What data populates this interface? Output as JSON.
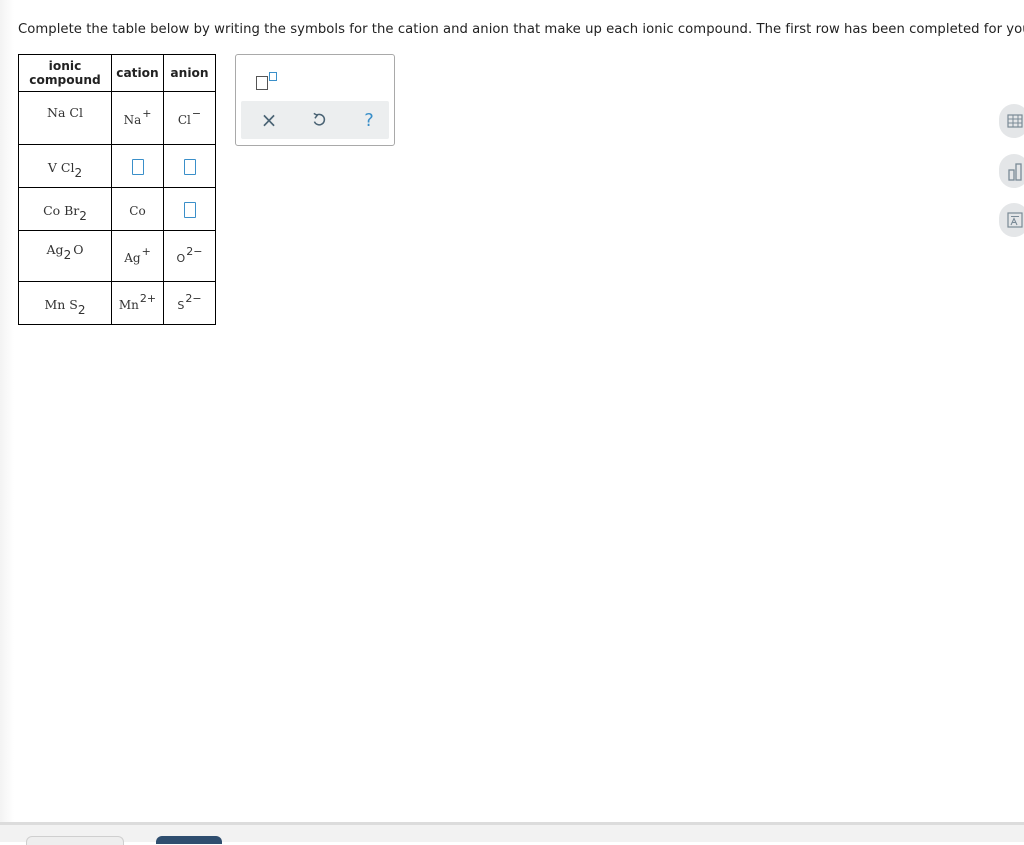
{
  "instructions": "Complete the table below by writing the symbols for the cation and anion that make up each ionic compound. The first row has been completed for you.",
  "table": {
    "headers": {
      "compound_line1": "ionic",
      "compound_line2": "compound",
      "cation": "cation",
      "anion": "anion"
    },
    "rows": [
      {
        "compound": {
          "base": "Na Cl",
          "sub": ""
        },
        "cation": {
          "symbol": "Na",
          "charge": "+"
        },
        "anion": {
          "symbol": "Cl",
          "charge": "−"
        }
      },
      {
        "compound": {
          "base": "V Cl",
          "sub": "2"
        },
        "cation": "blank",
        "anion": "blank"
      },
      {
        "compound": {
          "base": "Co Br",
          "sub": "2"
        },
        "cation": {
          "symbol": "Co",
          "charge": ""
        },
        "anion": "blank"
      },
      {
        "compound": {
          "base1": "Ag",
          "sub": "2",
          "base2": "O"
        },
        "cation": {
          "symbol": "Ag",
          "charge": "+"
        },
        "anion": {
          "symbol": "O",
          "charge": "2−"
        }
      },
      {
        "compound": {
          "base": "Mn S",
          "sub": "2"
        },
        "cation": {
          "symbol": "Mn",
          "charge": "2+"
        },
        "anion": {
          "symbol": "S",
          "charge": "2−"
        }
      }
    ]
  },
  "palette": {
    "superscript_tool_icon": "superscript-box-icon",
    "clear_symbol": "×",
    "undo_icon": "undo-icon",
    "help_symbol": "?"
  },
  "side_tools": [
    "table-icon",
    "bar-chart-icon",
    "periodic-table-icon"
  ],
  "colors": {
    "blank_border": "#3a8fc9",
    "palette_bar": "#eceeef",
    "footer_button": "#2f4e6f"
  }
}
